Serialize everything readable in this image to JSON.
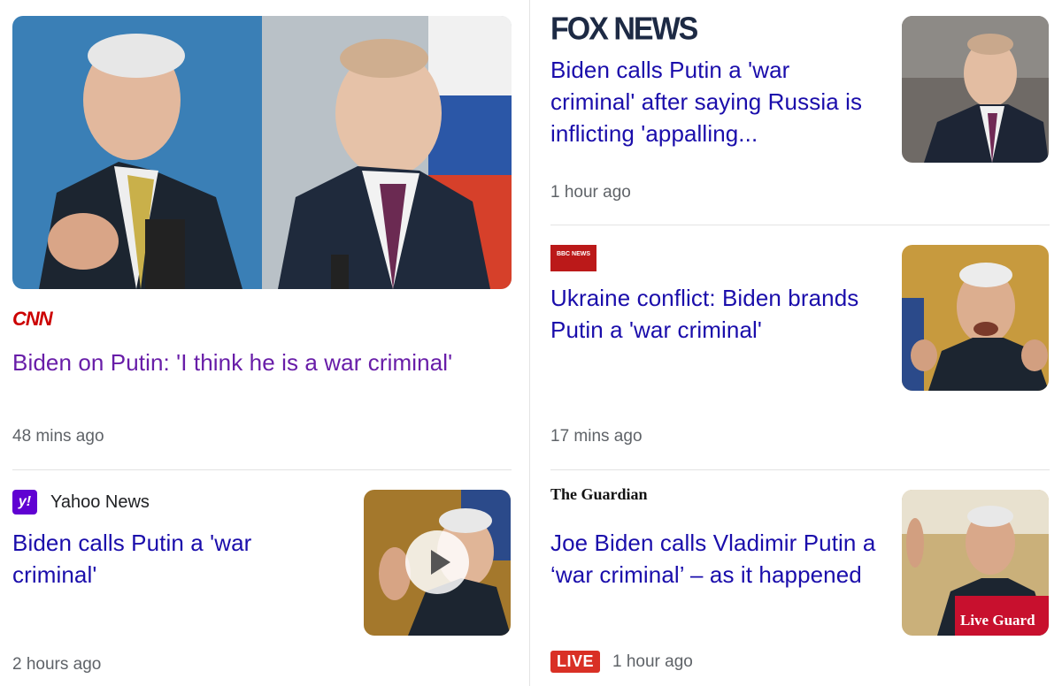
{
  "articles": {
    "cnn": {
      "source": "CNN",
      "headline": "Biden on Putin: 'I think he is a war criminal'",
      "time": "48 mins ago"
    },
    "fox": {
      "source": "FOX NEWS",
      "headline": "Biden calls Putin a 'war criminal' after saying Russia is inflicting 'appalling...",
      "time": "1 hour ago"
    },
    "bbc": {
      "source": "BBC NEWS",
      "headline": "Ukraine conflict: Biden brands Putin a 'war criminal'",
      "time": "17 mins ago"
    },
    "yahoo": {
      "logo_text": "y!",
      "source": "Yahoo News",
      "headline": "Biden calls Putin a 'war criminal'",
      "time": "2 hours ago"
    },
    "guardian": {
      "source": "The Guardian",
      "headline": "Joe Biden calls Vladimir Putin a ‘war criminal’ – as it happened",
      "live": "LIVE",
      "time": "1 hour ago",
      "thumb_overlay": "Live Guard"
    }
  },
  "colors": {
    "link": "#1a0dab",
    "visited": "#681da8",
    "meta": "#5f6368",
    "live": "#d93025"
  }
}
